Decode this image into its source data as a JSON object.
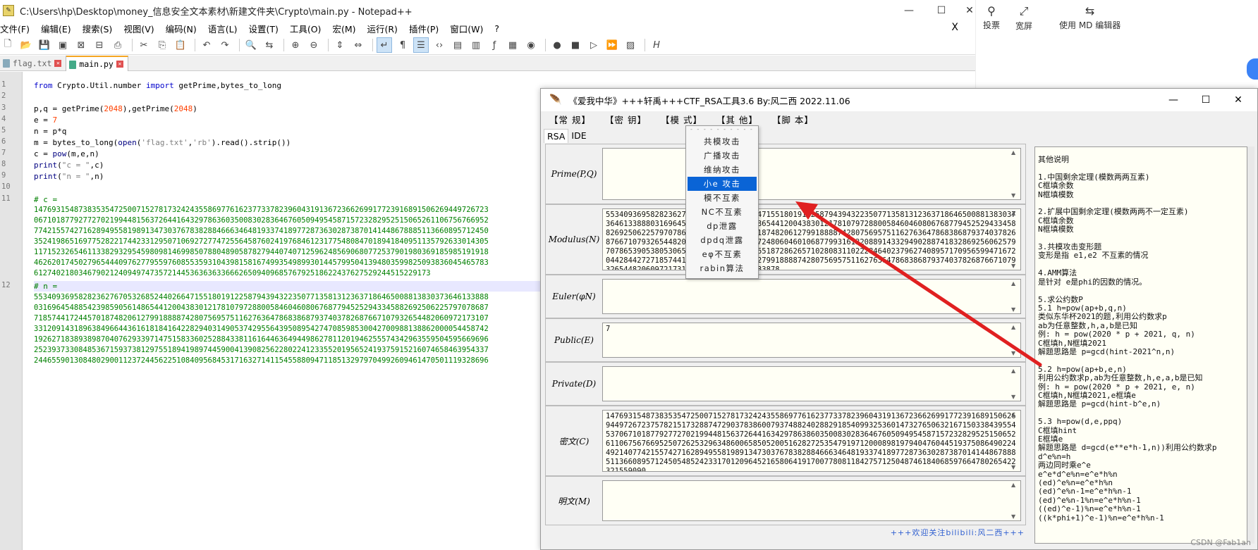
{
  "notepad": {
    "title": "C:\\Users\\hp\\Desktop\\money_信息安全文本素材\\新建文件夹\\Crypto\\main.py - Notepad++",
    "menu": [
      "文件(F)",
      "编辑(E)",
      "搜索(S)",
      "视图(V)",
      "编码(N)",
      "语言(L)",
      "设置(T)",
      "工具(O)",
      "宏(M)",
      "运行(R)",
      "插件(P)",
      "窗口(W)",
      "?"
    ],
    "close_doc": "X",
    "tabs": [
      {
        "label": "flag.txt",
        "selected": false
      },
      {
        "label": "main.py",
        "selected": true
      }
    ],
    "lines": {
      "l1": {
        "kw1": "from",
        "mod": " Crypto.Util.number ",
        "kw2": "import",
        "rest": " getPrime,bytes_to_long"
      },
      "l3": {
        "a": "p,q = getPrime(",
        "n1": "2048",
        "b": "),getPrime(",
        "n2": "2048",
        "c": ")"
      },
      "l4": {
        "a": "e = ",
        "n": "7"
      },
      "l5": {
        "a": "n = p*q"
      },
      "l6": {
        "a": "m = bytes_to_long(",
        "f1": "open",
        "b": "(",
        "s1": "'flag.txt'",
        "c": ",",
        "s2": "'rb'",
        "d": ").read().strip())"
      },
      "l7": {
        "a": "c = ",
        "f": "pow",
        "b": "(m,e,n)"
      },
      "l8": {
        "f": "print",
        "a": "(",
        "s": "\"c = \"",
        "b": ",c)"
      },
      "l9": {
        "f": "print",
        "a": "(",
        "s": "\"n = \"",
        "b": ",n)"
      },
      "l11": "# c = ",
      "c_lines": [
        "147693154873835354725007152781732424355869776162377337823960431913672366269917723916891506269449726723",
        "067101877927727021994481563726441643297863603500830283646760509495458715723282952515065261106756766952",
        "774215574271628949558198913473037678382884666346481933741897728736302873870141448678885113660895712450",
        "352419865169775282217442331295071069272774725564587602419768461231775480847018941840951135792633014305",
        "117152326546113382932954598098146998507880489058782794407407125962485690680772537901980369185985191918",
        "462620174502796544409762779559760855359310439815816749935498993014457995041394803599825093836045465783",
        "61274021803467902124094974735721445363636336662650940968576792518622437627529244515229173"
      ],
      "l12": "# n = ",
      "n_lines": [
        "553409369582823627670532685244026647155180191225879439432235077135813123637186465008813830373646133888",
        "031696454885423985905614865441200438301217810797288005846046080676877945252943345882692506225797078687",
        "718574417244570187482061279918888742807569575116276364786838687937403782687667107932654482060972173107",
        "331209143189638496644361618184164228294031490537429556439508954274708598530042700988138862000054458742",
        "192627183893898704076293397147515833602528843381161644636494498627811201946255574342963559504595669696",
        "252393733084853671593738129755189419897445900413908256228022412335520195652419375915216074658463954337",
        "244655901308480290011237244562251084095684531716327141154558809471185132979704992609461470501119328696"
      ]
    }
  },
  "right_panel": {
    "items": [
      {
        "icon": "vote-icon",
        "label": "投票"
      },
      {
        "icon": "wide-icon",
        "label": "宽屏"
      },
      {
        "icon": "md-editor-icon",
        "label": "使用 MD 编辑器"
      }
    ]
  },
  "rsa_tool": {
    "title": "《爱我中华》+++轩禹+++CTF_RSA工具3.6  By:风二西 2022.11.06",
    "menu": [
      "【常    规】",
      "【密    钥】",
      "【模    式】",
      "【其    他】",
      "【脚    本】"
    ],
    "tabs": [
      "RSA",
      "IDE"
    ],
    "fields": [
      {
        "label": "Prime(P,Q)",
        "value": ""
      },
      {
        "label": "Modulus(N)",
        "value": "553409369582823627670532685244026647155180191225879439432235077135813123637186465008813830373646133888031696454885423985905614865441200438301217810797288005846046080676877945252943345882692506225797078687185744172445701874820612799188887428075695751162763647868386879374037826876671079326544820609721731078985972480604601068779931613208891433294902887418328692560625797078653905380530651390617109384088651872862657102808311022284640237962740895717095659947167204428442727185744172445701874820612799188887428075695751162763647868386879374037826876671079326544820609721731078985096813307183878"
      },
      {
        "label": "Euler(φN)",
        "value": ""
      },
      {
        "label": "Public(E)",
        "value": "7"
      },
      {
        "label": "Private(D)",
        "value": ""
      },
      {
        "label": "密文(C)",
        "value": "147693154873835354725007152781732424355869776162377337823960431913672366269917723916891506269449726723757821517328874729037838600793748824028829185409932536014732765063216715033843955453706710187792772702199448156372644163429786386035008302836467605094954587157232829525150652611067567669525072625329634860065850520051628272535479197120008981979404760445193750864902244921407742155742716289495581989134730376783828846663464819337418977287363028738701414486788851136608957124505485242331701209645216580641917007780811842757125048746184068597664780265422321559090"
      },
      {
        "label": "明文(M)",
        "value": ""
      }
    ],
    "notes_title": "其他说明",
    "notes": "其他说明\n\n1.中国剩余定理(模数两两互素)\nC框填余数\nN框填模数\n\n2.扩展中国剩余定理(模数两两不一定互素)\nC框填余数\nN框填模数\n\n3.共模攻击变形题\n变形是指 e1,e2 不互素的情况\n\n4.AMM算法\n是针对 e是phi的因数的情况。\n\n5.求公约数P\n5.1 h=pow(ap+b,q,n)\n类似东华杯2021的题,利用公约数求p\nab为任意整数,h,a,b是已知\n例: h = pow(2020 * p + 2021, q, n)\nC框填h,N框填2021\n解题思路是 p=gcd(hint-2021^n,n)\n\n5.2 h=pow(ap+b,e,n)\n利用公约数求p,ab为任意整数,h,e,a,b是已知\n例: h = pow(2020 * p + 2021, e, n)\nC框填h,N框填2021,e框填e\n解题思路是 p=gcd(hint-b^e,n)\n\n5.3 h=pow(d,e,ppq)\nC框填hint\nE框填e\n解题思路是 d=gcd(e**e*h-1,n))利用公约数求p\nd^e%n=h\n两边同时乘e^e\ne^e*d^e%n=e^e*h%n\n(ed)^e%n=e^e*h%n\n(ed)^e%n-1=e^e*h%n-1\n(ed)^e%n-1%n=e^e*h%n-1\n((ed)^e-1)%n=e^e*h%n-1\n((k*phi+1)^e-1)%n=e^e*h%n-1",
    "footer": "+++欢迎关注bilibili:风二西+++",
    "dropdown": {
      "items": [
        "共模攻击",
        "广播攻击",
        "维纳攻击",
        "小e 攻击",
        "模不互素",
        "NC不互素",
        "dp泄露",
        "dpdq泄露",
        "eφ不互素",
        "rabin算法"
      ],
      "highlighted": 3
    }
  },
  "watermark": "CSDN @Fab1an"
}
